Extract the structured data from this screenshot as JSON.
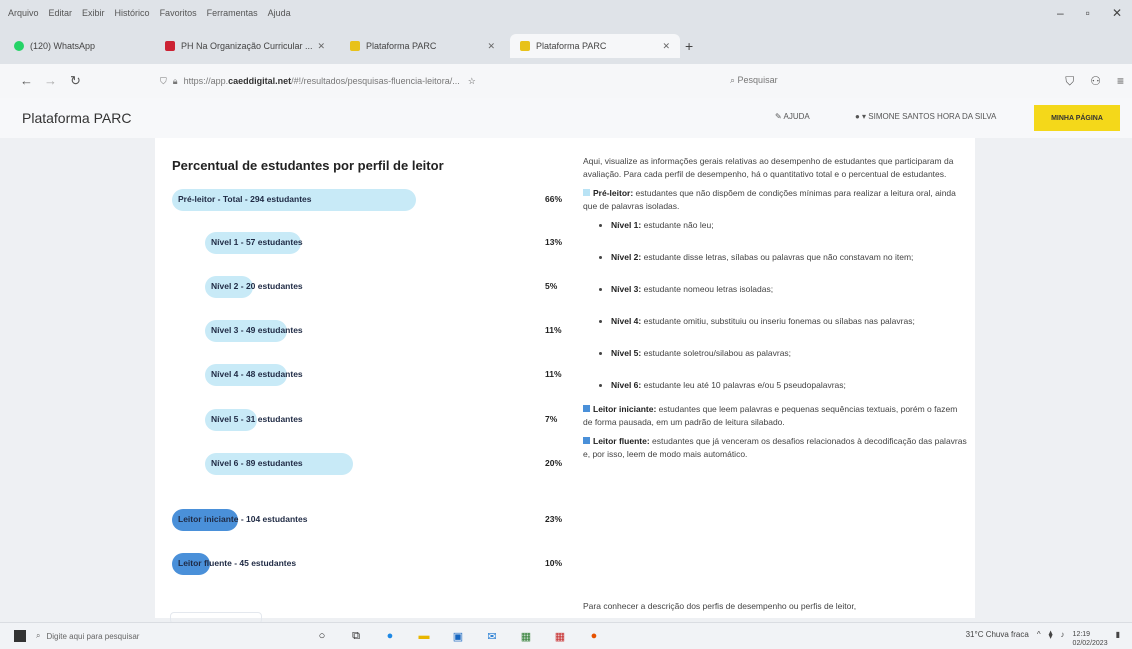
{
  "browser": {
    "menus": [
      "Arquivo",
      "Editar",
      "Exibir",
      "Histórico",
      "Favoritos",
      "Ferramentas",
      "Ajuda"
    ],
    "tabs": [
      {
        "label": "(120) WhatsApp",
        "color": "#25d366"
      },
      {
        "label": "PH Na Organização Curricular ... ",
        "color": "#c23"
      },
      {
        "label": "Plataforma PARC",
        "color": "#e8c21a"
      },
      {
        "label": "Plataforma PARC",
        "color": "#e8c21a"
      }
    ],
    "url_prefix": "https://app.",
    "url_domain": "caeddigital.net",
    "url_suffix": "/#!/resultados/pesquisas-fluencia-leitora/...",
    "search_placeholder": "Pesquisar"
  },
  "app": {
    "brand": "Plataforma PARC",
    "help": "AJUDA",
    "user": "SIMONE SANTOS HORA DA SILVA",
    "minha_pagina": "MINHA PÁGINA"
  },
  "chart_data": {
    "type": "bar",
    "title": "Percentual de estudantes por perfil de leitor",
    "rows": [
      {
        "label": "Pré-leitor - Total - 294 estudantes",
        "value": 66,
        "pct": "66%",
        "indent": false,
        "color": "#c8eaf7"
      },
      {
        "label": "Nível 1 - 57 estudantes",
        "value": 13,
        "pct": "13%",
        "indent": true,
        "color": "#c8eaf7"
      },
      {
        "label": "Nível 2 - 20 estudantes",
        "value": 5,
        "pct": "5%",
        "indent": true,
        "color": "#c8eaf7"
      },
      {
        "label": "Nível 3 - 49 estudantes",
        "value": 11,
        "pct": "11%",
        "indent": true,
        "color": "#c8eaf7"
      },
      {
        "label": "Nível 4 - 48 estudantes",
        "value": 11,
        "pct": "11%",
        "indent": true,
        "color": "#c8eaf7"
      },
      {
        "label": "Nível 5 - 31 estudantes",
        "value": 7,
        "pct": "7%",
        "indent": true,
        "color": "#c8eaf7"
      },
      {
        "label": "Nível 6 - 89 estudantes",
        "value": 20,
        "pct": "20%",
        "indent": true,
        "color": "#c8eaf7"
      },
      {
        "label": "Leitor iniciante - 104 estudantes",
        "value": 23,
        "pct": "23%",
        "indent": false,
        "color": "#4a90d9"
      },
      {
        "label": "Leitor fluente - 45 estudantes",
        "value": 10,
        "pct": "10%",
        "indent": false,
        "color": "#4a90d9"
      }
    ]
  },
  "info": {
    "intro": "Aqui, visualize as informações gerais relativas ao desempenho de estudantes que participaram da avaliação. Para cada perfil de desempenho, há o quantitativo total e o percentual de estudantes.",
    "preleitor_title": "Pré-leitor:",
    "preleitor_text": " estudantes que não dispõem de condições mínimas para realizar a leitura oral, ainda que de palavras isoladas.",
    "levels": [
      {
        "name": "Nível 1:",
        "text": " estudante não leu;"
      },
      {
        "name": "Nível 2:",
        "text": " estudante disse letras, sílabas ou palavras que não constavam no item;"
      },
      {
        "name": "Nível 3:",
        "text": " estudante nomeou letras isoladas;"
      },
      {
        "name": "Nível 4:",
        "text": " estudante omitiu, substituiu ou inseriu fonemas ou sílabas nas palavras;"
      },
      {
        "name": "Nível 5:",
        "text": " estudante soletrou/silabou as palavras;"
      },
      {
        "name": "Nível 6:",
        "text": " estudante leu até 10 palavras e/ou 5 pseudopalavras;"
      }
    ],
    "iniciante_title": "Leitor iniciante:",
    "iniciante_text": " estudantes que leem palavras e pequenas sequências textuais, porém o fazem de forma pausada, em um padrão de leitura silabado.",
    "fluente_title": "Leitor fluente:",
    "fluente_text": " estudantes que já venceram os desafios relacionados à decodificação das palavras e, por isso, leem de modo mais automático.",
    "footer": "Para conhecer a descrição dos perfis de desempenho ou perfis de leitor,"
  },
  "taskbar": {
    "search_placeholder": "Digite aqui para pesquisar",
    "weather": "31°C Chuva fraca",
    "time": "12:19",
    "date": "02/02/2023"
  }
}
